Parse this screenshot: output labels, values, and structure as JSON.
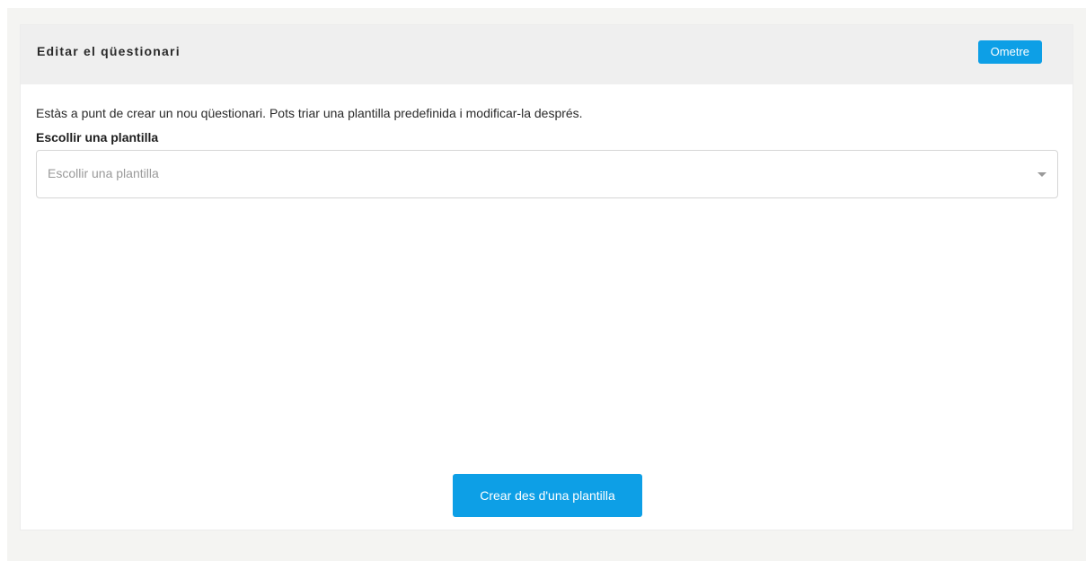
{
  "panel": {
    "title": "Editar el qüestionari",
    "skip_label": "Ometre"
  },
  "content": {
    "intro": "Estàs a punt de crear un nou qüestionari. Pots triar una plantilla predefinida i modificar-la després.",
    "template_label": "Escollir una plantilla",
    "template_select": {
      "placeholder": "Escollir una plantilla",
      "caret_icon": "caret-down-icon"
    },
    "create_label": "Crear des d'una plantilla"
  },
  "colors": {
    "accent": "#0d9fe6",
    "header_bg": "#efefef",
    "page_bg": "#f4f4f2"
  }
}
